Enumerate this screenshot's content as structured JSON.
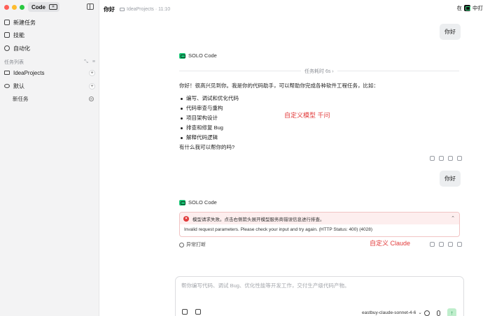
{
  "app": {
    "mode_label": "Code",
    "mode_kbd": "⌘"
  },
  "sidebar": {
    "items": [
      {
        "label": "新建任务",
        "icon": "new-task-icon"
      },
      {
        "label": "技能",
        "icon": "skills-icon"
      },
      {
        "label": "自动化",
        "icon": "automation-icon"
      }
    ],
    "section_label": "任务列表",
    "projects": [
      {
        "label": "IdeaProjects",
        "icon": "folder-icon"
      },
      {
        "label": "默认",
        "icon": "cloud-icon"
      }
    ],
    "tasks": [
      {
        "label": "新任务"
      }
    ]
  },
  "header": {
    "title": "你好",
    "breadcrumb": "IdeaProjects · 11:10",
    "right_text": "在",
    "right_text2": "中打"
  },
  "chat": {
    "user_message_1": "你好",
    "agent_name": "SOLO Code",
    "duration": "任务耗时 6s ›",
    "answer_intro": "你好！很高兴见到你。我是你的代码助手，可以帮助你完成各种软件工程任务，比如：",
    "answer_items": [
      "编写、调试和优化代码",
      "代码审查与重构",
      "项目架构设计",
      "排查和修复 Bug",
      "解释代码逻辑"
    ],
    "answer_outro": "有什么我可以帮你的吗?",
    "note_1": "自定义模型 千问",
    "user_message_2": "你好",
    "agent_name_2": "SOLO Code",
    "error_title": "模型请求失败。点击右侧箭头展开模型服务商错误信息进行排查。",
    "error_detail": "Invalid request parameters. Please check your input and try again. (HTTP Status: 400) (4028)",
    "abnormal_label": "异常打断",
    "note_2": "自定义 Claude"
  },
  "composer": {
    "placeholder": "帮你编写代码、调试 Bug、优化性能等开发工作，交付生产级代码产物。",
    "model": "eastbuy-claude-sonnet-4-6"
  },
  "colors": {
    "accent_green": "#16c172",
    "error_red": "#e03a3a",
    "note_red": "#e23b3b"
  }
}
